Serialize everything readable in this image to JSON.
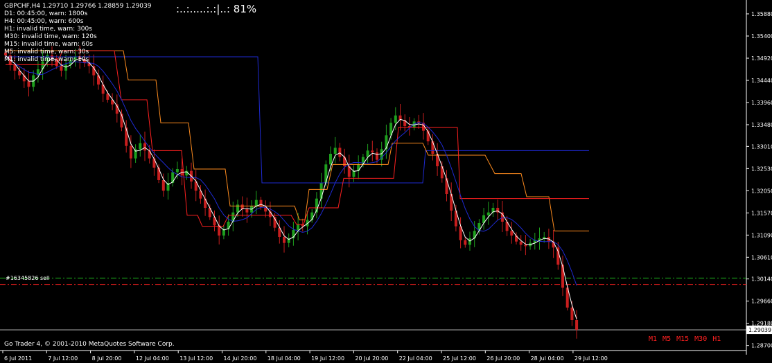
{
  "header": {
    "info_lines": [
      "GBPCHF,H4  1.29710 1.29766 1.28859 1.29039",
      "D1: 00:45:00, warn: 1800s",
      "H4: 00:45:00, warn: 600s",
      "H1: invalid time, warn: 300s",
      "M30: invalid time, warn: 120s",
      "M15: invalid time, warn: 60s",
      "M5: invalid time, warn: 30s",
      "M1: invalid time, warn: 10s"
    ],
    "progress_text": ":..:.....:.:|..:  81%"
  },
  "footer": {
    "copyright": "Go Trader 4, © 2001-2010 MetaQuotes Software Corp."
  },
  "order": {
    "label": "#16345826 sell"
  },
  "timeframe_buttons": [
    "M1",
    "M5",
    "M15",
    "M30",
    "H1"
  ],
  "colors": {
    "bull": "#1ea01e",
    "bear": "#c81e1e",
    "blue": "#1e2ad2",
    "orange": "#ff8c1e",
    "red": "#ff2020",
    "white": "#ffffff",
    "green_dash": "#1eb41e",
    "red_dash": "#e61e1e"
  },
  "chart_data": {
    "type": "candlestick",
    "symbol": "GBPCHF",
    "timeframe": "H4",
    "ohlc_current": {
      "open": 1.2971,
      "high": 1.29766,
      "low": 1.28859,
      "close": 1.29039
    },
    "current_price_label": "1.29039",
    "y_range": [
      1.2856,
      1.3612
    ],
    "price_ticks": [
      "1.35880",
      "1.35400",
      "1.34920",
      "1.34440",
      "1.33960",
      "1.33480",
      "1.33010",
      "1.32530",
      "1.32050",
      "1.31570",
      "1.31090",
      "1.30610",
      "1.30140",
      "1.29660",
      "1.29180",
      "1.28700"
    ],
    "time_ticks": [
      "6 Jul 2011",
      "7 Jul 12:00",
      "8 Jul 20:00",
      "12 Jul 04:00",
      "13 Jul 12:00",
      "14 Jul 20:00",
      "18 Jul 04:00",
      "19 Jul 12:00",
      "20 Jul 20:00",
      "22 Jul 04:00",
      "25 Jul 12:00",
      "26 Jul 20:00",
      "28 Jul 04:00",
      "29 Jul 12:00"
    ],
    "close_path": [
      1.3498,
      1.3478,
      1.3465,
      1.3455,
      1.3442,
      1.343,
      1.3455,
      1.3468,
      1.3485,
      1.3498,
      1.3492,
      1.3475,
      1.3465,
      1.3478,
      1.3488,
      1.3496,
      1.349,
      1.3482,
      1.3475,
      1.3455,
      1.3435,
      1.3415,
      1.3402,
      1.3392,
      1.3372,
      1.3342,
      1.3302,
      1.3275,
      1.3295,
      1.3308,
      1.3292,
      1.3275,
      1.3255,
      1.3228,
      1.3205,
      1.3222,
      1.3245,
      1.3252,
      1.3238,
      1.3248,
      1.3225,
      1.3205,
      1.3188,
      1.3168,
      1.3148,
      1.313,
      1.3108,
      1.3122,
      1.3138,
      1.3158,
      1.3175,
      1.3165,
      1.3158,
      1.3172,
      1.3185,
      1.317,
      1.316,
      1.3148,
      1.3125,
      1.3105,
      1.3092,
      1.3102,
      1.312,
      1.3132,
      1.3128,
      1.3142,
      1.3158,
      1.3188,
      1.3222,
      1.3262,
      1.3285,
      1.3298,
      1.3278,
      1.3258,
      1.3235,
      1.3248,
      1.3262,
      1.3278,
      1.3292,
      1.3288,
      1.3272,
      1.3295,
      1.3325,
      1.3352,
      1.3368,
      1.3358,
      1.3345,
      1.3342,
      1.3355,
      1.3352,
      1.3335,
      1.3312,
      1.3285,
      1.3258,
      1.3232,
      1.3198,
      1.3162,
      1.3128,
      1.3098,
      1.3088,
      1.3102,
      1.3118,
      1.3135,
      1.3152,
      1.3158,
      1.3168,
      1.3158,
      1.3138,
      1.3118,
      1.3108,
      1.3095,
      1.3088,
      1.3085,
      1.3092,
      1.3098,
      1.3102,
      1.3105,
      1.3095,
      1.3082,
      1.3045,
      1.2995,
      1.2952,
      1.2925,
      1.2904
    ],
    "series": [
      {
        "name": "blue-1",
        "color": "#1e2ad2",
        "points": [
          [
            8,
            1.3495
          ],
          [
            372,
            1.3495
          ],
          [
            378,
            1.3222
          ],
          [
            610,
            1.3222
          ],
          [
            614,
            1.3292
          ],
          [
            850,
            1.3292
          ]
        ]
      },
      {
        "name": "orange-upper",
        "color": "#ff8c1e",
        "points": [
          [
            8,
            1.3508
          ],
          [
            178,
            1.3508
          ],
          [
            185,
            1.3445
          ],
          [
            225,
            1.3445
          ],
          [
            232,
            1.3352
          ],
          [
            272,
            1.3352
          ],
          [
            280,
            1.3252
          ],
          [
            325,
            1.3252
          ],
          [
            332,
            1.3172
          ],
          [
            425,
            1.3172
          ],
          [
            432,
            1.3142
          ],
          [
            440,
            1.3142
          ],
          [
            446,
            1.3208
          ],
          [
            472,
            1.3208
          ],
          [
            480,
            1.3262
          ],
          [
            560,
            1.3262
          ],
          [
            566,
            1.3308
          ],
          [
            610,
            1.3308
          ],
          [
            618,
            1.3282
          ],
          [
            700,
            1.3282
          ],
          [
            714,
            1.3242
          ],
          [
            752,
            1.3242
          ],
          [
            760,
            1.3192
          ],
          [
            792,
            1.3192
          ],
          [
            800,
            1.3118
          ],
          [
            850,
            1.3118
          ]
        ]
      },
      {
        "name": "red-upper",
        "color": "#ff2020",
        "points": [
          [
            8,
            1.3478
          ],
          [
            82,
            1.3478
          ],
          [
            90,
            1.3508
          ],
          [
            165,
            1.3508
          ],
          [
            175,
            1.3402
          ],
          [
            212,
            1.3402
          ],
          [
            220,
            1.3292
          ],
          [
            262,
            1.3292
          ],
          [
            270,
            1.3152
          ],
          [
            285,
            1.3152
          ],
          [
            292,
            1.3128
          ],
          [
            322,
            1.3128
          ],
          [
            330,
            1.3152
          ],
          [
            420,
            1.3152
          ],
          [
            428,
            1.3132
          ],
          [
            438,
            1.3132
          ],
          [
            446,
            1.3168
          ],
          [
            488,
            1.3168
          ],
          [
            496,
            1.3232
          ],
          [
            568,
            1.3232
          ],
          [
            575,
            1.3342
          ],
          [
            660,
            1.3342
          ],
          [
            664,
            1.3188
          ],
          [
            850,
            1.3188
          ]
        ]
      }
    ],
    "horizontal_levels": [
      {
        "name": "order-level",
        "price": 1.3016,
        "color": "#1eb41e",
        "style": "dashdot"
      },
      {
        "name": "order-level-2",
        "price": 1.3002,
        "color": "#e61e1e",
        "style": "dashdot"
      },
      {
        "name": "current-price-line",
        "price": 1.29039,
        "color": "#c8c8c8",
        "style": "solid"
      }
    ],
    "grid": false
  }
}
